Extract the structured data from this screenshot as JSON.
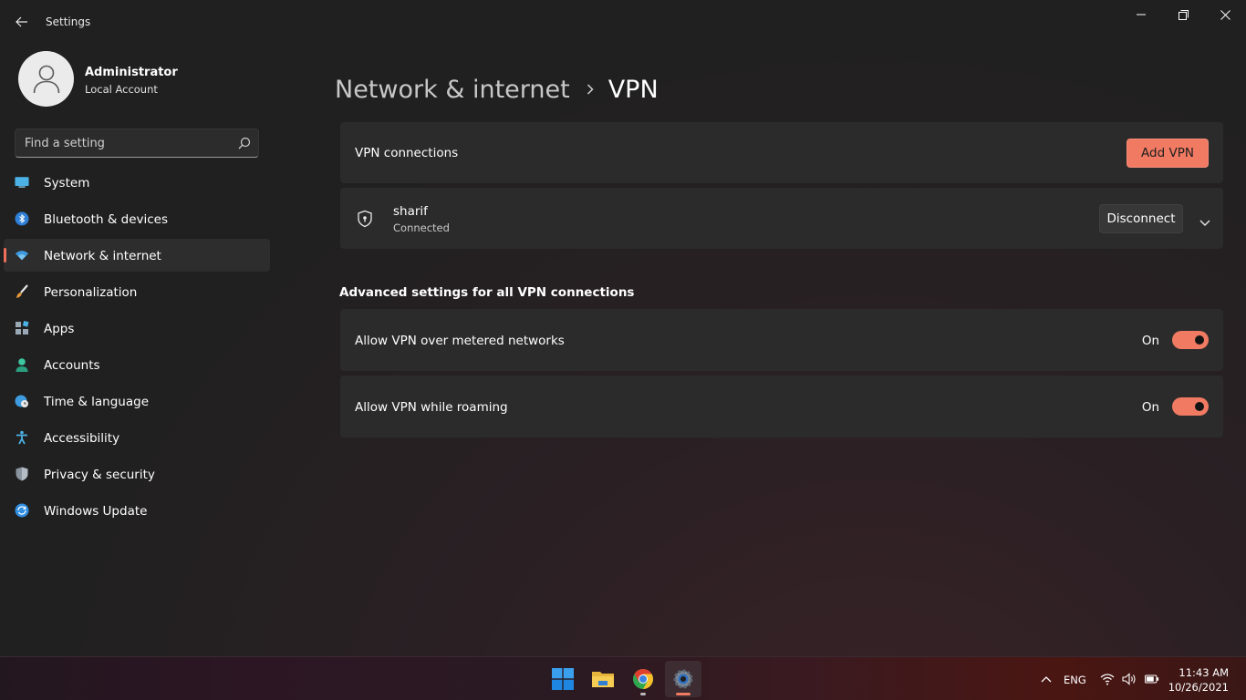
{
  "window": {
    "title": "Settings",
    "controls": [
      "minimize-icon",
      "maximize-icon",
      "close-icon"
    ]
  },
  "profile": {
    "name": "Administrator",
    "account_type": "Local Account"
  },
  "search": {
    "placeholder": "Find a setting"
  },
  "sidebar": {
    "items": [
      {
        "label": "System",
        "icon": "monitor-icon"
      },
      {
        "label": "Bluetooth & devices",
        "icon": "bluetooth-icon"
      },
      {
        "label": "Network & internet",
        "icon": "wifi-icon",
        "active": true
      },
      {
        "label": "Personalization",
        "icon": "brush-icon"
      },
      {
        "label": "Apps",
        "icon": "apps-icon"
      },
      {
        "label": "Accounts",
        "icon": "person-icon"
      },
      {
        "label": "Time & language",
        "icon": "globe-clock-icon"
      },
      {
        "label": "Accessibility",
        "icon": "accessibility-icon"
      },
      {
        "label": "Privacy & security",
        "icon": "shield-icon"
      },
      {
        "label": "Windows Update",
        "icon": "update-icon"
      }
    ]
  },
  "main": {
    "breadcrumb": {
      "parent": "Network & internet",
      "current": "VPN"
    },
    "vpn_connections": {
      "label": "VPN connections",
      "add_button": "Add VPN"
    },
    "connection": {
      "name": "sharif",
      "status": "Connected",
      "disconnect_button": "Disconnect"
    },
    "advanced": {
      "title": "Advanced settings for all VPN connections",
      "settings": [
        {
          "label": "Allow VPN over metered networks",
          "state": "On",
          "enabled": true
        },
        {
          "label": "Allow VPN while roaming",
          "state": "On",
          "enabled": true
        }
      ]
    }
  },
  "taskbar": {
    "apps": [
      {
        "name": "start-button",
        "icon": "windows-logo-icon"
      },
      {
        "name": "file-explorer",
        "icon": "folder-icon"
      },
      {
        "name": "chrome",
        "icon": "chrome-icon"
      },
      {
        "name": "settings",
        "icon": "gear-icon",
        "active": true
      }
    ],
    "tray": {
      "language": "ENG",
      "time": "11:43 AM",
      "date": "10/26/2021"
    }
  },
  "colors": {
    "accent": "#f07a62",
    "background": "#202020",
    "card": "#2b2b2b"
  }
}
